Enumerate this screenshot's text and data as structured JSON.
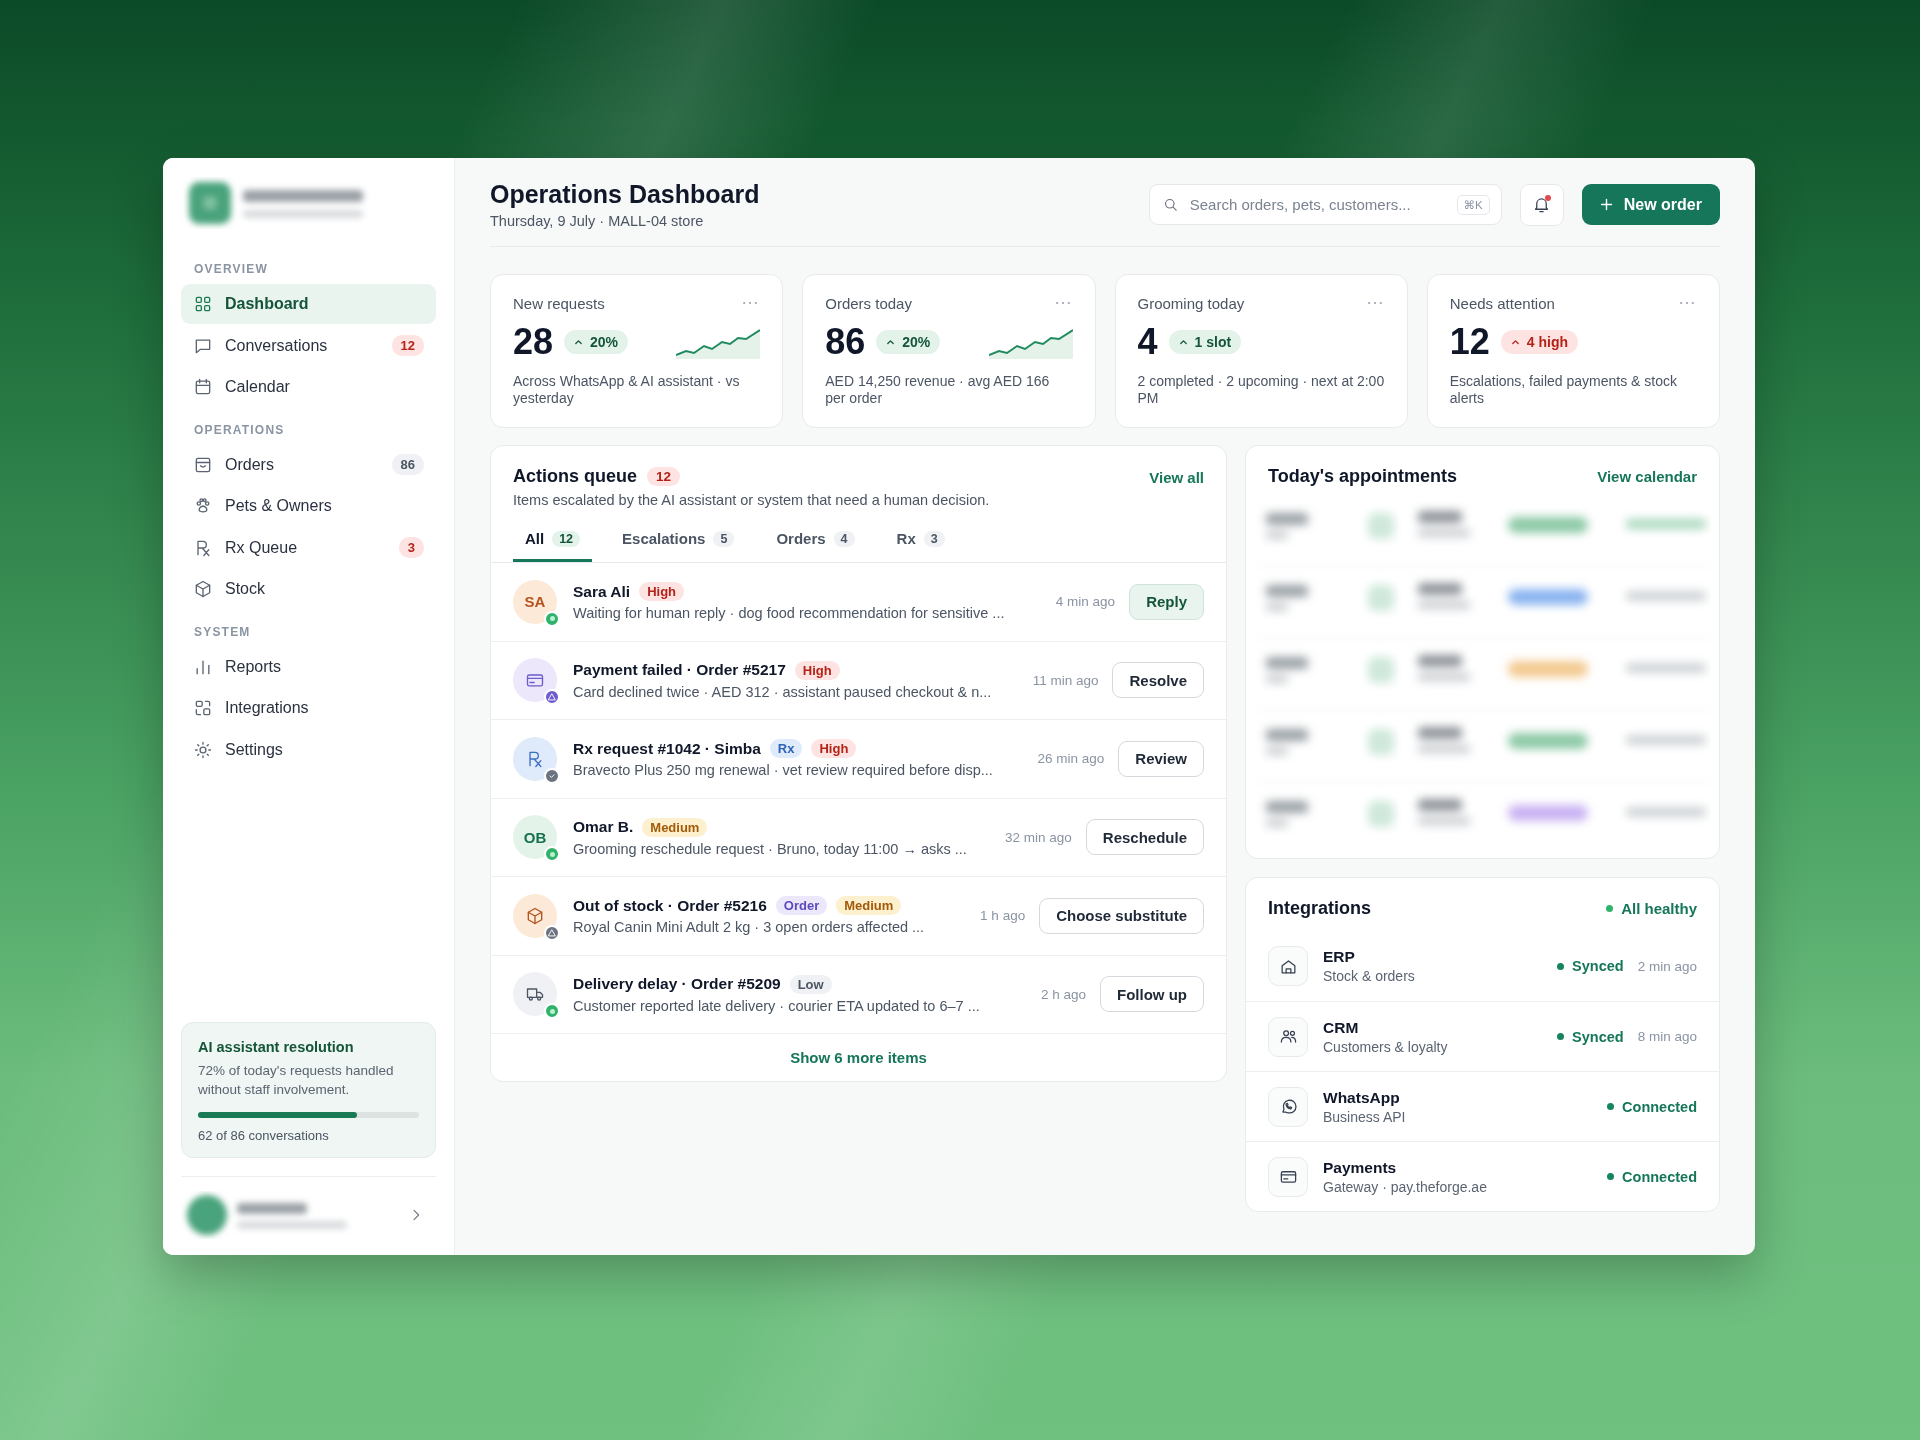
{
  "sidebar": {
    "sections": [
      {
        "title": "OVERVIEW",
        "items": [
          {
            "label": "Dashboard",
            "kind": "grid",
            "selected": true
          },
          {
            "label": "Conversations",
            "kind": "chat",
            "selected": false,
            "badge": {
              "text": "12",
              "kind": "alert"
            }
          },
          {
            "label": "Calendar",
            "kind": "calendar",
            "selected": false
          }
        ]
      },
      {
        "title": "OPERATIONS",
        "items": [
          {
            "label": "Orders",
            "kind": "bag",
            "selected": false,
            "badge": {
              "text": "86",
              "kind": "neutral"
            }
          },
          {
            "label": "Pets & Owners",
            "kind": "paw",
            "selected": false
          },
          {
            "label": "Rx Queue",
            "kind": "rx",
            "selected": false,
            "badge": {
              "text": "3",
              "kind": "alert"
            }
          },
          {
            "label": "Stock",
            "kind": "cube",
            "selected": false
          }
        ]
      },
      {
        "title": "SYSTEM",
        "items": [
          {
            "label": "Reports",
            "kind": "bars",
            "selected": false
          },
          {
            "label": "Integrations",
            "kind": "blocks",
            "selected": false
          },
          {
            "label": "Settings",
            "kind": "sun",
            "selected": false
          }
        ]
      }
    ],
    "promo": {
      "title": "AI assistant resolution",
      "text": "72% of today's requests handled without staff involvement.",
      "level": 0.72,
      "caption": "62 of 86 conversations"
    }
  },
  "header": {
    "title": "Operations Dashboard",
    "subtitle": "Thursday, 9 July · MALL-04 store",
    "search": {
      "placeholder": "Search orders, pets, customers...",
      "shortcut": "⌘K"
    },
    "notifications": {
      "unread": true
    },
    "button": "New order"
  },
  "stats": [
    {
      "label": "New requests",
      "value": "28",
      "delta": {
        "text": "20%",
        "kind": "positive"
      },
      "note": "Across WhatsApp & AI assistant · vs yesterday",
      "sparkline": true
    },
    {
      "label": "Orders today",
      "value": "86",
      "delta": {
        "text": "20%",
        "kind": "positive"
      },
      "note": "AED 14,250 revenue · avg AED 166 per order",
      "sparkline": true
    },
    {
      "label": "Grooming today",
      "value": "4",
      "delta": {
        "text": "1 slot",
        "kind": "positive"
      },
      "note": "2 completed · 2 upcoming · next at 2:00 PM",
      "sparkline": false
    },
    {
      "label": "Needs attention",
      "value": "12",
      "delta": {
        "text": "4 high",
        "kind": "negative"
      },
      "note": "Escalations, failed payments & stock alerts",
      "sparkline": false
    }
  ],
  "actions": {
    "title": "Actions queue",
    "count": "12",
    "subtitle": "Items escalated by the AI assistant or system that need a human decision.",
    "link": "View all",
    "tabs": [
      {
        "label": "All",
        "count": "12",
        "selected": true
      },
      {
        "label": "Escalations",
        "count": "5",
        "selected": false
      },
      {
        "label": "Orders",
        "count": "4",
        "selected": false
      },
      {
        "label": "Rx",
        "count": "3",
        "selected": false
      }
    ],
    "items": [
      {
        "avatar": {
          "kind": "initials",
          "initials": "SA",
          "color": "#fde9d7"
        },
        "status": {
          "kind": "online"
        },
        "title": "Sara Ali",
        "tags": [
          {
            "label": "High",
            "kind": "high"
          }
        ],
        "text": "Waiting for human reply · dog food recommendation for sensitive ...",
        "time": "4 min ago",
        "action": "Reply",
        "emphasis": true
      },
      {
        "avatar": {
          "kind": "card",
          "color": "#ece7fb"
        },
        "status": {
          "kind": "warning"
        },
        "title": "Payment failed · Order #5217",
        "tags": [
          {
            "label": "High",
            "kind": "high"
          }
        ],
        "text": "Card declined twice · AED 312 · assistant paused checkout & n...",
        "time": "11 min ago",
        "action": "Resolve",
        "emphasis": false
      },
      {
        "avatar": {
          "kind": "rx",
          "color": "#dfeafb"
        },
        "status": {
          "kind": "done"
        },
        "title": "Rx request #1042 · Simba",
        "tags": [
          {
            "label": "Rx",
            "kind": "category"
          },
          {
            "label": "High",
            "kind": "high"
          }
        ],
        "text": "Bravecto Plus 250 mg renewal · vet review required before disp...",
        "time": "26 min ago",
        "action": "Review",
        "emphasis": false
      },
      {
        "avatar": {
          "kind": "initials",
          "initials": "OB",
          "color": "#e3f3ea"
        },
        "status": {
          "kind": "online"
        },
        "title": "Omar B.",
        "tags": [
          {
            "label": "Medium",
            "kind": "medium"
          }
        ],
        "text": "Grooming reschedule request · Bruno, today 11:00 → asks ...",
        "time": "32 min ago",
        "action": "Reschedule",
        "emphasis": false
      },
      {
        "avatar": {
          "kind": "cube",
          "color": "#fde9d7"
        },
        "status": {
          "kind": "warning"
        },
        "title": "Out of stock · Order #5216",
        "tags": [
          {
            "label": "Order",
            "kind": "order"
          },
          {
            "label": "Medium",
            "kind": "medium"
          }
        ],
        "text": "Royal Canin Mini Adult 2 kg · 3 open orders affected ...",
        "time": "1 h ago",
        "action": "Choose substitute",
        "emphasis": false
      },
      {
        "avatar": {
          "kind": "truck",
          "color": "#f0f1f4"
        },
        "status": {
          "kind": "online"
        },
        "title": "Delivery delay · Order #5209",
        "tags": [
          {
            "label": "Low",
            "kind": "low"
          }
        ],
        "text": "Customer reported late delivery · courier ETA updated to 6–7 ...",
        "time": "2 h ago",
        "action": "Follow up",
        "emphasis": false
      }
    ],
    "footer": "Show 6 more items"
  },
  "appointments": {
    "title": "Today's appointments",
    "link": "View calendar"
  },
  "integrations": {
    "title": "Integrations",
    "status": "All healthy",
    "items": [
      {
        "kind": "house",
        "name": "ERP",
        "description": "Stock & orders",
        "status": "Synced",
        "time": "2 min ago"
      },
      {
        "kind": "users",
        "name": "CRM",
        "description": "Customers & loyalty",
        "status": "Synced",
        "time": "8 min ago"
      },
      {
        "kind": "whatsapp",
        "name": "WhatsApp",
        "description": "Business API",
        "status": "Connected"
      },
      {
        "kind": "card",
        "name": "Payments",
        "description": "Gateway · pay.theforge.ae",
        "status": "Connected"
      }
    ]
  }
}
